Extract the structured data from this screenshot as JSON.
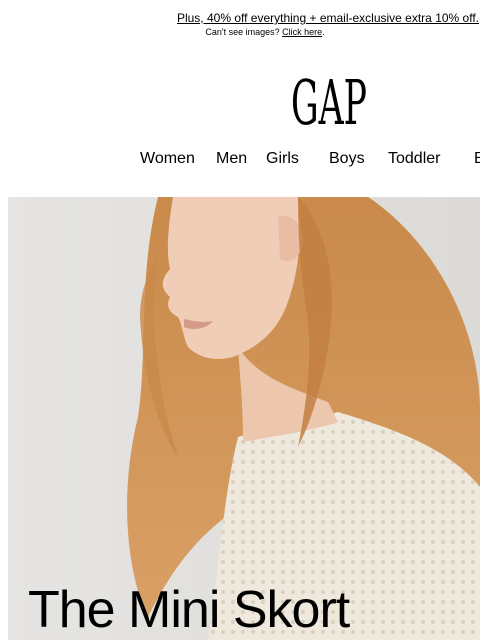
{
  "header": {
    "promo_text": "Plus, 40% off everything + email-exclusive extra 10% off.",
    "cant_see_text": "Can't see images?",
    "click_here_label": "Click here",
    "cant_see_suffix": "."
  },
  "brand": {
    "logo_text": "GAP"
  },
  "nav": {
    "items": [
      "Women",
      "Men",
      "Girls",
      "Boys",
      "Toddler",
      "B"
    ]
  },
  "hero": {
    "headline": "The Mini Skort"
  },
  "colors": {
    "background": "#ffffff",
    "text": "#000000",
    "hero_backdrop": "#e3e2e0"
  }
}
